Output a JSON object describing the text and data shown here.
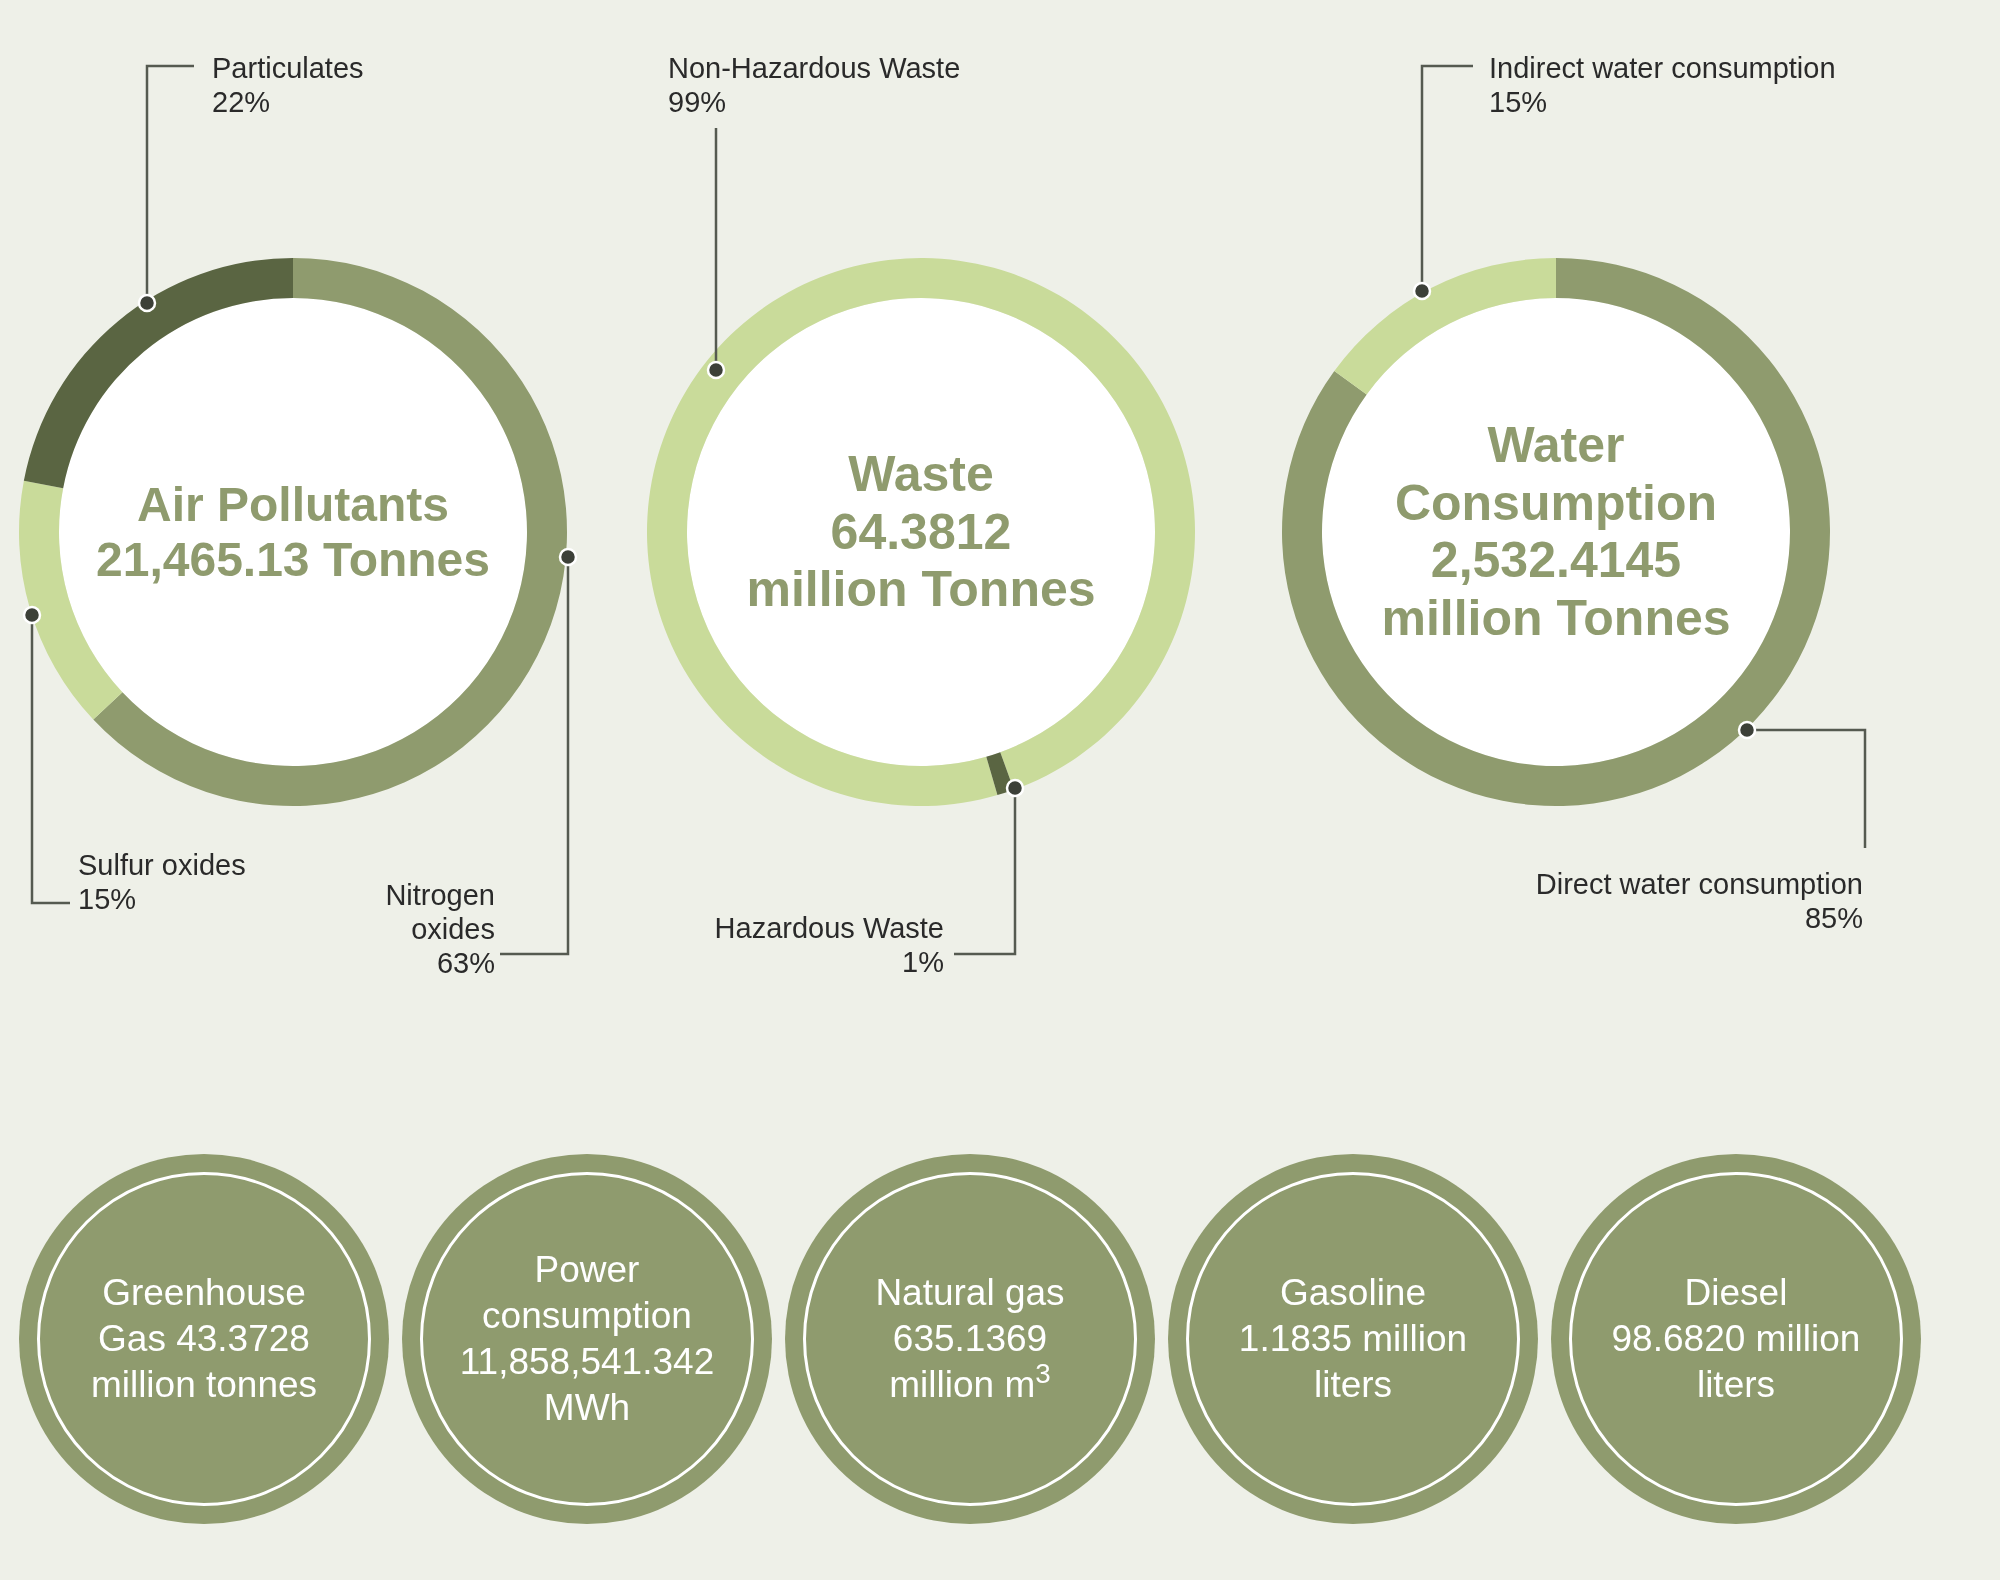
{
  "donuts": [
    {
      "title_lines": [
        "Air Pollutants",
        "21,465.13 Tonnes"
      ],
      "chart_data": {
        "type": "donut",
        "categories": [
          "Nitrogen oxides",
          "Sulfur oxides",
          "Particulates"
        ],
        "values": [
          63,
          15,
          22
        ],
        "colors": [
          "#8f9b6e",
          "#c9db9a",
          "#5a6542"
        ],
        "data_labels": true,
        "value_labels": [
          "63%",
          "15%",
          "22%"
        ]
      }
    },
    {
      "title_lines": [
        "Waste",
        "64.3812",
        "million Tonnes"
      ],
      "chart_data": {
        "type": "donut",
        "categories": [
          "Non-Hazardous Waste",
          "Hazardous Waste"
        ],
        "values": [
          99,
          1
        ],
        "colors": [
          "#c9db9a",
          "#5a6542"
        ],
        "data_labels": true,
        "value_labels": [
          "99%",
          "1%"
        ]
      }
    },
    {
      "title_lines": [
        "Water",
        "Consumption",
        "2,532.4145",
        "million Tonnes"
      ],
      "chart_data": {
        "type": "donut",
        "categories": [
          "Direct water consumption",
          "Indirect water consumption"
        ],
        "values": [
          85,
          15
        ],
        "colors": [
          "#8f9b6e",
          "#c9db9a"
        ],
        "data_labels": true,
        "value_labels": [
          "85%",
          "15%"
        ]
      }
    }
  ],
  "stats": [
    {
      "lines": [
        "Greenhouse",
        "Gas 43.3728",
        "million tonnes"
      ]
    },
    {
      "lines": [
        "Power",
        "consumption",
        "11,858,541.342",
        "MWh"
      ]
    },
    {
      "lines": [
        "Natural gas",
        "635.1369",
        "million m$^{3}$"
      ]
    },
    {
      "lines": [
        "Gasoline",
        "1.1835 million",
        "liters"
      ]
    },
    {
      "lines": [
        "Diesel",
        "98.6820 million",
        "liters"
      ]
    }
  ]
}
